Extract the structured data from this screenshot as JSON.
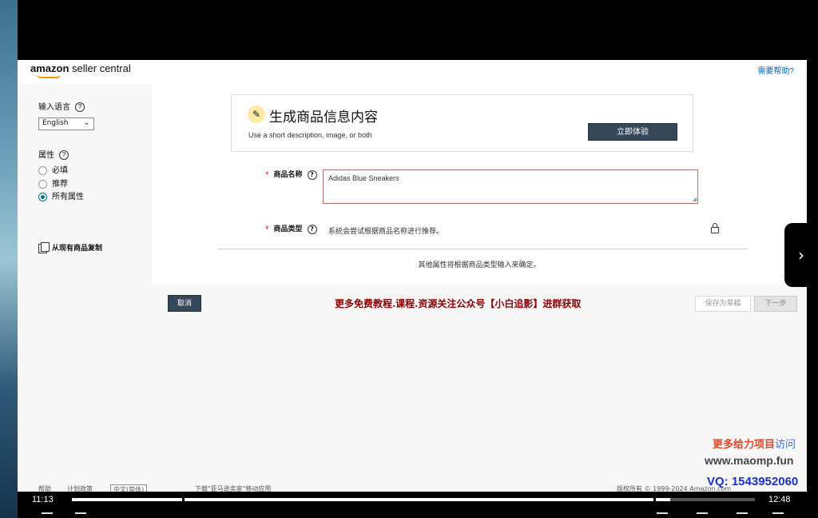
{
  "header": {
    "logo_brand": "amazon",
    "logo_rest": " seller central",
    "help_link": "需要帮助?"
  },
  "sidebar": {
    "language_label": "输入语言",
    "language_value": "English",
    "attributes_label": "属性",
    "radios": [
      {
        "label": "必填",
        "checked": false
      },
      {
        "label": "推荐",
        "checked": false
      },
      {
        "label": "所有属性",
        "checked": true
      }
    ],
    "copy_label": "从现有商品复制"
  },
  "generate_card": {
    "title": "生成商品信息内容",
    "description": "Use a short description, image, or both",
    "button_label": "立即体验"
  },
  "form": {
    "required_mark": "*",
    "product_name_label": "商品名称",
    "product_name_value": "Adidas Blue Sneakers",
    "product_type_label": "商品类型",
    "product_type_hint": "系统会尝试根据商品名称进行推荐。",
    "other_attributes_note": "其他属性将根据商品类型输入来确定。"
  },
  "actions": {
    "cancel_label": "取消",
    "save_draft_label": "保存为草稿",
    "next_label": "下一步"
  },
  "promo_text": "更多免费教程.课程.资源关注公众号【小白追影】进群获取",
  "footer": {
    "help": "帮助",
    "policy": "计划政策",
    "language": "中文(简体)",
    "app_download": "下载\"亚马逊卖家\"移动应用",
    "copyright": "版权所有 © 1999-2024 Amazon.com"
  },
  "watermark": {
    "line1_red": "更多给力项目",
    "line1_blue": "访问",
    "line2": "www.maomp.fun",
    "line3": "VQ: 1543952060"
  },
  "player": {
    "current_time": "11:13",
    "total_time": "12:48",
    "progress": 0.876
  }
}
